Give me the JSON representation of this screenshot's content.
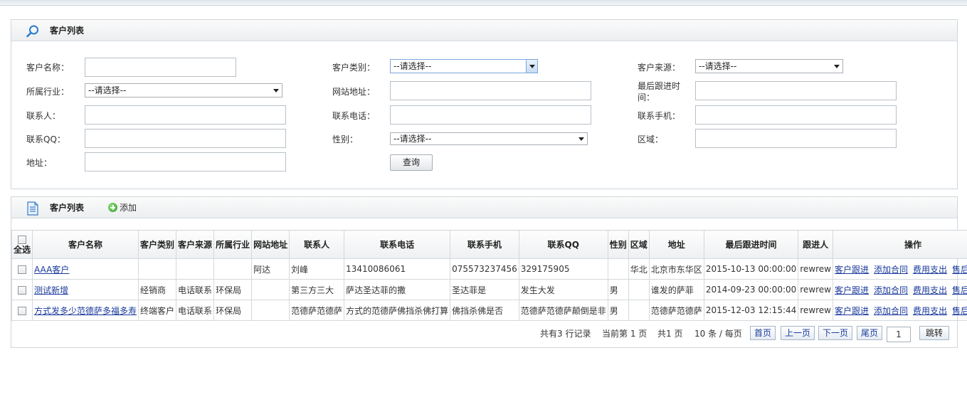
{
  "search": {
    "title": "客户列表",
    "fields": {
      "name": {
        "label": "客户名称：",
        "value": ""
      },
      "category": {
        "label": "客户类别：",
        "selected": "--请选择--"
      },
      "source": {
        "label": "客户来源：",
        "selected": "--请选择--"
      },
      "industry": {
        "label": "所属行业：",
        "selected": "--请选择--"
      },
      "website": {
        "label": "网站地址：",
        "value": ""
      },
      "last_follow_l1": "最后跟进时",
      "last_follow_l2": "间：",
      "contact": {
        "label": "联系人：",
        "value": ""
      },
      "phone": {
        "label": "联系电话：",
        "value": ""
      },
      "mobile": {
        "label": "联系手机：",
        "value": ""
      },
      "qq": {
        "label": "联系QQ：",
        "value": ""
      },
      "gender": {
        "label": "性别：",
        "selected": "--请选择--"
      },
      "region": {
        "label": "区域：",
        "value": ""
      },
      "address": {
        "label": "地址：",
        "value": ""
      }
    },
    "query_button": "查询"
  },
  "list": {
    "title": "客户列表",
    "add_label": "添加",
    "select_all": "全选",
    "columns": [
      "客户名称",
      "客户类别",
      "客户来源",
      "所属行业",
      "网站地址",
      "联系人",
      "联系电话",
      "联系手机",
      "联系QQ",
      "性别",
      "区域",
      "地址",
      "最后跟进时间",
      "跟进人",
      "操作"
    ],
    "rows": [
      [
        "AAA客户",
        "",
        "",
        "",
        "阿达",
        "刘峰",
        "13410086061",
        "075573237456",
        "329175905",
        "",
        "华北",
        "北京市东华区",
        "2015-10-13 00:00:00",
        "rewrew"
      ],
      [
        "测试新增",
        "经销商",
        "电话联系",
        "环保局",
        "",
        "第三方三大",
        "萨达圣达菲的撒",
        "圣达菲是",
        "发生大发",
        "男",
        "",
        "谁发的萨菲",
        "2014-09-23 00:00:00",
        "rewrew"
      ],
      [
        "方式发多少范德萨多福多寿",
        "终端客户",
        "电话联系",
        "环保局",
        "",
        "范德萨范德萨",
        "方式的范德萨佛挡杀佛打算",
        "佛挡杀佛是否",
        "范德萨范德萨颠倒是非",
        "男",
        "",
        "范德萨范德萨",
        "2015-12-03 12:15:44",
        "rewrew"
      ]
    ],
    "actions": [
      "客户跟进",
      "添加合同",
      "费用支出",
      "售后跟踪"
    ]
  },
  "pager": {
    "total": "共有3 行记录",
    "current": "当前第 1 页",
    "pages": "共1 页",
    "per_page": "10 条 / 每页",
    "first": "首页",
    "prev": "上一页",
    "next": "下一页",
    "last": "尾页",
    "page_input": "1",
    "jump": "跳转"
  }
}
